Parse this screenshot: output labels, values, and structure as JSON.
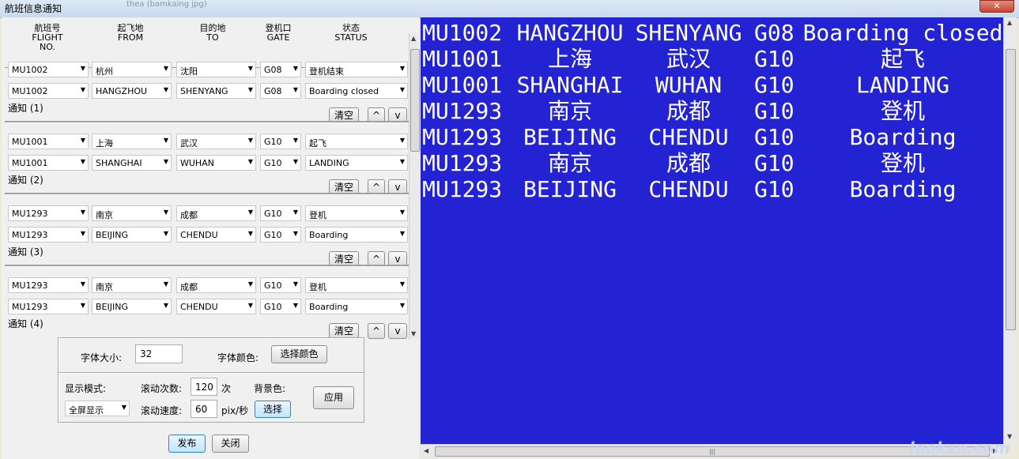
{
  "window": {
    "title": "航班信息通知",
    "blurred_text": "thea (bamkaing jpg)"
  },
  "headers": [
    {
      "cn": "航班号",
      "en": "FLIGHT NO."
    },
    {
      "cn": "起飞地",
      "en": "FROM"
    },
    {
      "cn": "目的地",
      "en": "TO"
    },
    {
      "cn": "登机口",
      "en": "GATE"
    },
    {
      "cn": "状态",
      "en": "STATUS"
    }
  ],
  "notices": [
    {
      "label": "通知 (1)",
      "rows": [
        {
          "flight": "MU1002",
          "from": "杭州",
          "to": "沈阳",
          "gate": "G08",
          "status": "登机结束"
        },
        {
          "flight": "MU1002",
          "from": "HANGZHOU",
          "to": "SHENYANG",
          "gate": "G08",
          "status": "Boarding closed"
        }
      ]
    },
    {
      "label": "通知 (2)",
      "rows": [
        {
          "flight": "MU1001",
          "from": "上海",
          "to": "武汉",
          "gate": "G10",
          "status": "起飞"
        },
        {
          "flight": "MU1001",
          "from": "SHANGHAI",
          "to": "WUHAN",
          "gate": "G10",
          "status": "LANDING"
        }
      ]
    },
    {
      "label": "通知 (3)",
      "rows": [
        {
          "flight": "MU1293",
          "from": "南京",
          "to": "成都",
          "gate": "G10",
          "status": "登机"
        },
        {
          "flight": "MU1293",
          "from": "BEIJING",
          "to": "CHENDU",
          "gate": "G10",
          "status": "Boarding"
        }
      ]
    },
    {
      "label": "通知 (4)",
      "rows": [
        {
          "flight": "MU1293",
          "from": "南京",
          "to": "成都",
          "gate": "G10",
          "status": "登机"
        },
        {
          "flight": "MU1293",
          "from": "BEIJING",
          "to": "CHENDU",
          "gate": "G10",
          "status": "Boarding"
        }
      ]
    }
  ],
  "group_buttons": {
    "clear": "清空",
    "up": "^",
    "down": "v"
  },
  "font_settings": {
    "size_label": "字体大小:",
    "size_value": "32",
    "color_label": "字体颜色:",
    "color_button": "选择颜色"
  },
  "display_settings": {
    "mode_label": "显示模式:",
    "mode_value": "全屏显示",
    "scroll_count_label": "滚动次数:",
    "scroll_count_value": "120",
    "scroll_count_unit": "次",
    "scroll_speed_label": "滚动速度:",
    "scroll_speed_value": "60",
    "scroll_speed_unit": "pix/秒",
    "bg_label": "背景色:",
    "bg_button": "选择",
    "apply_button": "应用"
  },
  "bottom_buttons": {
    "publish": "发布",
    "close": "关闭"
  },
  "display_lines": [
    {
      "flight": "MU1002",
      "from": "HANGZHOU",
      "to": "SHENYANG",
      "gate": "G08",
      "status": "Boarding closed"
    },
    {
      "flight": "MU1001",
      "from": "上海",
      "to": "武汉",
      "gate": "G10",
      "status": "起飞"
    },
    {
      "flight": "MU1001",
      "from": "SHANGHAI",
      "to": "WUHAN",
      "gate": "G10",
      "status": "LANDING"
    },
    {
      "flight": "MU1293",
      "from": "南京",
      "to": "成都",
      "gate": "G10",
      "status": "登机"
    },
    {
      "flight": "MU1293",
      "from": "BEIJING",
      "to": "CHENDU",
      "gate": "G10",
      "status": "Boarding"
    },
    {
      "flight": "MU1293",
      "from": "南京",
      "to": "成都",
      "gate": "G10",
      "status": "登机"
    },
    {
      "flight": "MU1293",
      "from": "BEIJING",
      "to": "CHENDU",
      "gate": "G10",
      "status": "Boarding"
    }
  ],
  "watermark": "lookzn.com",
  "colors": {
    "display_bg": "#2323d4",
    "display_text": "#ffffff"
  }
}
